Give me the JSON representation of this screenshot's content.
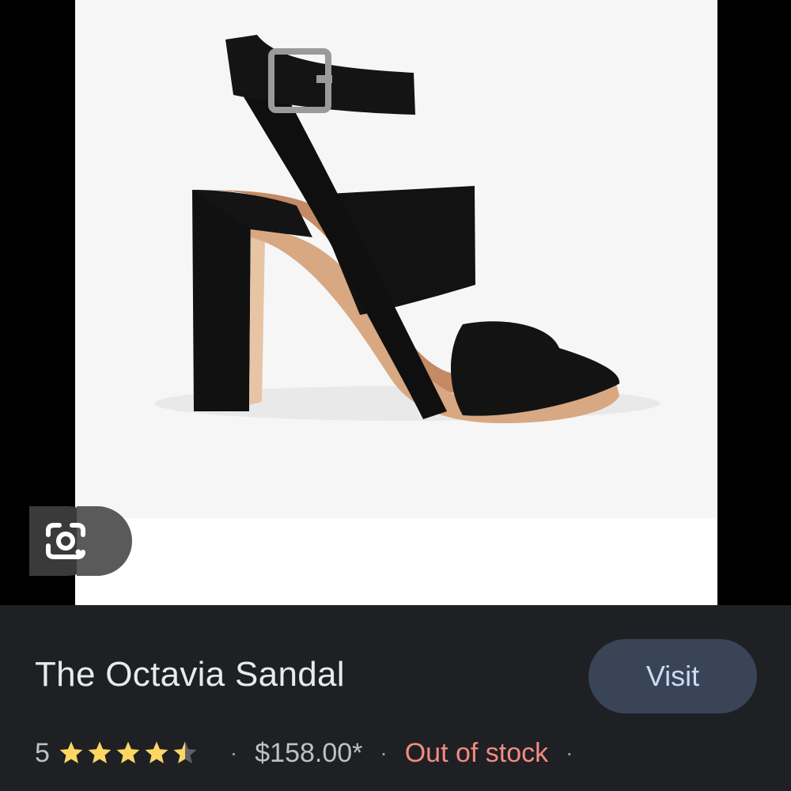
{
  "product": {
    "title": "The Octavia Sandal",
    "rating": "5",
    "rating_value": 4.5,
    "rating_max": 5,
    "price": "$158.00*",
    "stock_status": "Out of stock",
    "separator": "·"
  },
  "actions": {
    "visit_label": "Visit"
  },
  "icons": {
    "lens": "google-lens-icon",
    "star": "star-icon"
  },
  "colors": {
    "panel_bg": "#1f2024",
    "title": "#e8eaed",
    "visit_bg": "#394457",
    "visit_text": "#c8dcf5",
    "star": "#fdd663",
    "out_of_stock": "#f28b82"
  }
}
